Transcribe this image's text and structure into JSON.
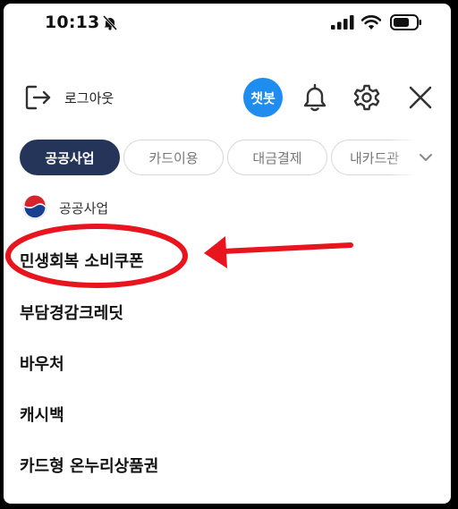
{
  "status_bar": {
    "time": "10:13"
  },
  "header": {
    "logout_label": "로그아웃",
    "chatbot_label": "챗봇"
  },
  "tabs": [
    {
      "label": "공공사업",
      "active": true
    },
    {
      "label": "카드이용",
      "active": false
    },
    {
      "label": "대금결제",
      "active": false
    },
    {
      "label": "내카드관",
      "active": false
    }
  ],
  "section": {
    "title": "공공사업",
    "items": [
      {
        "label": "민생회복 소비쿠폰"
      },
      {
        "label": "부담경감크레딧"
      },
      {
        "label": "바우처"
      },
      {
        "label": "캐시백"
      },
      {
        "label": "카드형 온누리상품권"
      }
    ]
  },
  "colors": {
    "accent_navy": "#25355a",
    "chatbot_blue": "#1f8cf0",
    "annotation_red": "#e8141e"
  },
  "icons": [
    "mute-icon",
    "signal-icon",
    "wifi-icon",
    "battery-icon",
    "logout-icon",
    "bell-icon",
    "gear-icon",
    "close-icon",
    "chevron-down-icon",
    "emblem-icon"
  ]
}
